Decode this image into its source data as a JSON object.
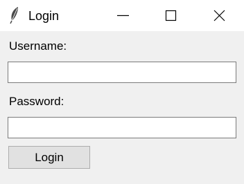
{
  "window": {
    "title": "Login",
    "icon": "feather-icon"
  },
  "form": {
    "username_label": "Username:",
    "username_value": "",
    "password_label": "Password:",
    "password_value": "",
    "login_button": "Login"
  }
}
